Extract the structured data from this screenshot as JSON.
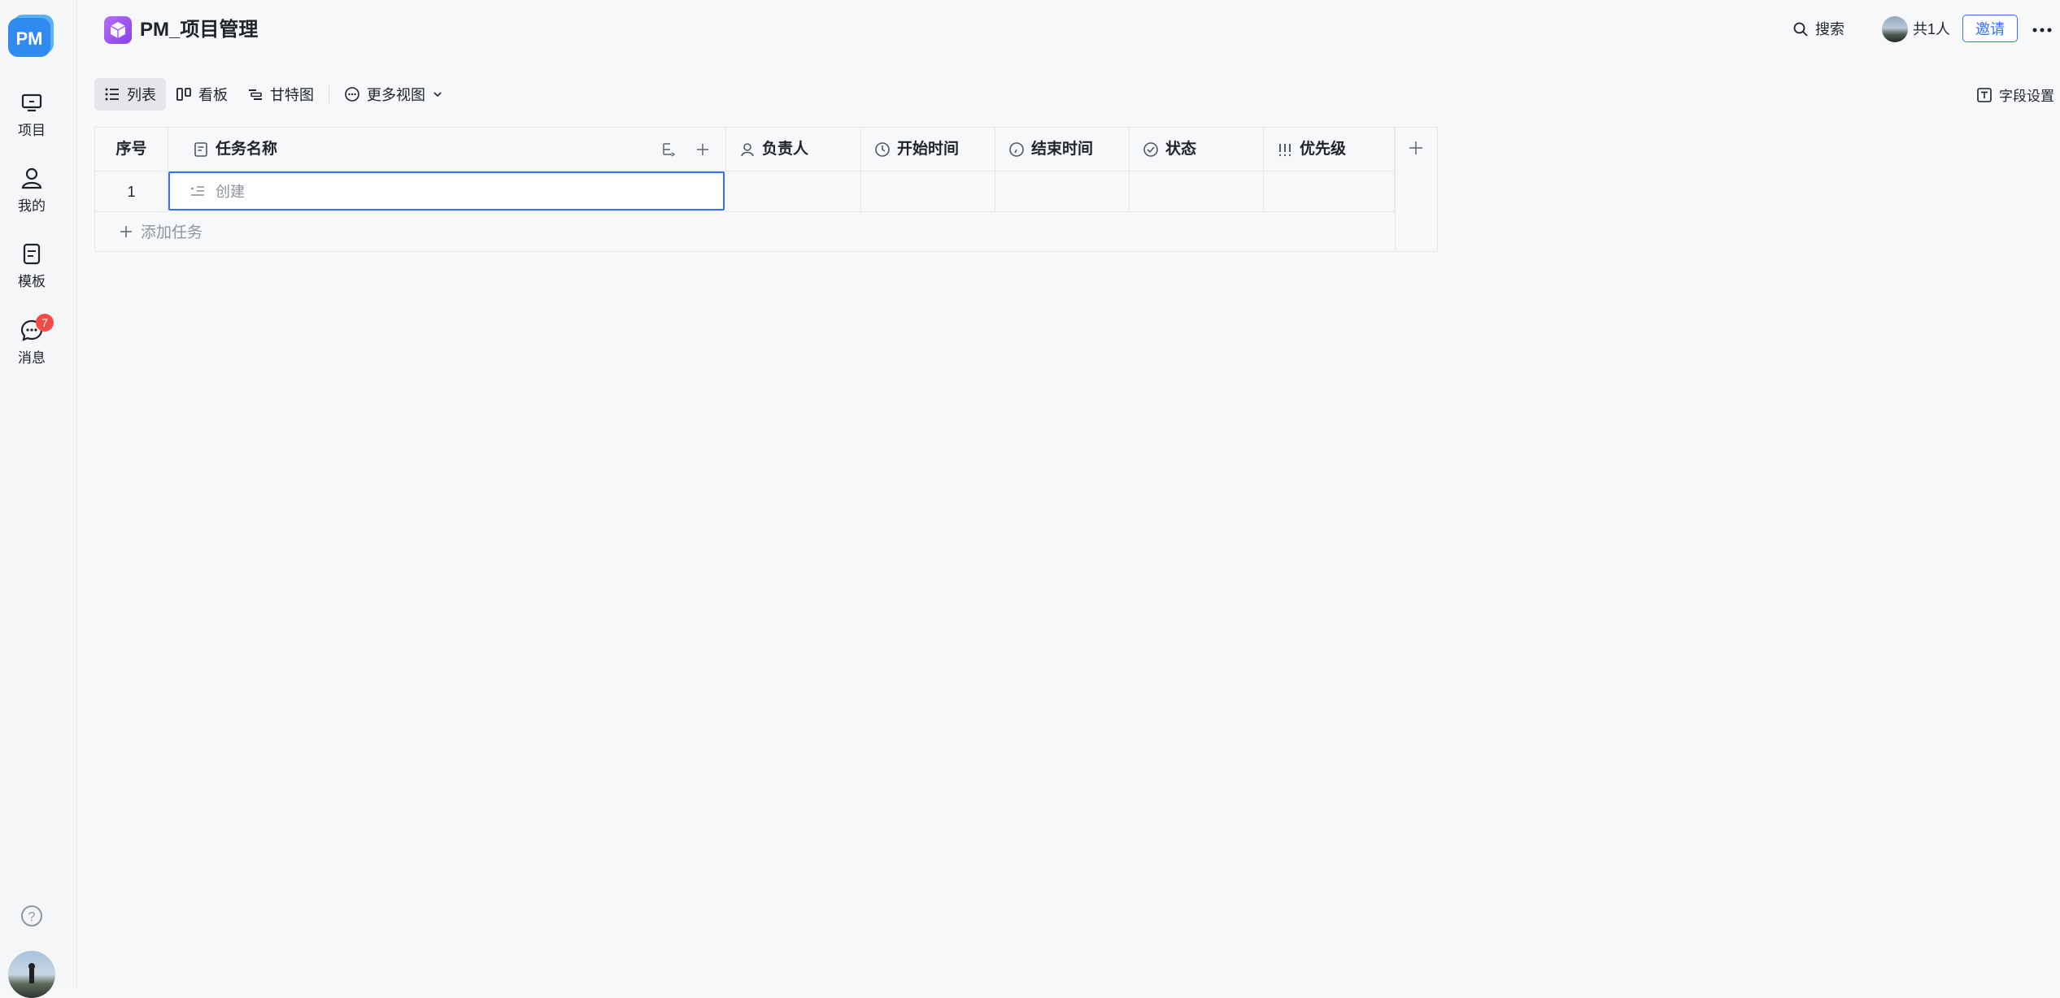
{
  "sidebar": {
    "logo_text": "PM",
    "items": [
      {
        "label": "项目",
        "icon": "monitor-icon"
      },
      {
        "label": "我的",
        "icon": "person-icon"
      },
      {
        "label": "模板",
        "icon": "document-icon"
      },
      {
        "label": "消息",
        "icon": "chat-icon",
        "badge": "7"
      }
    ],
    "help_icon": "question-icon"
  },
  "header": {
    "title": "PM_项目管理",
    "search_label": "搜索",
    "member_count": "共1人",
    "invite_label": "邀请"
  },
  "views": {
    "tabs": [
      {
        "label": "列表",
        "icon": "list-icon",
        "active": true
      },
      {
        "label": "看板",
        "icon": "kanban-icon",
        "active": false
      },
      {
        "label": "甘特图",
        "icon": "gantt-icon",
        "active": false
      }
    ],
    "more_label": "更多视图",
    "field_settings_label": "字段设置"
  },
  "table": {
    "columns": [
      {
        "label": "序号"
      },
      {
        "label": "任务名称",
        "icon": "text-field-icon"
      },
      {
        "label": "负责人",
        "icon": "person-icon"
      },
      {
        "label": "开始时间",
        "icon": "clock-icon"
      },
      {
        "label": "结束时间",
        "icon": "clock-icon"
      },
      {
        "label": "状态",
        "icon": "check-circle-icon"
      },
      {
        "label": "优先级",
        "icon": "priority-icon"
      }
    ],
    "rows": [
      {
        "index": "1",
        "task_name": "创建"
      }
    ],
    "add_task_label": "添加任务"
  },
  "colors": {
    "accent": "#3370ff",
    "badge": "#f54a45",
    "app_icon": "#9b52f0"
  }
}
